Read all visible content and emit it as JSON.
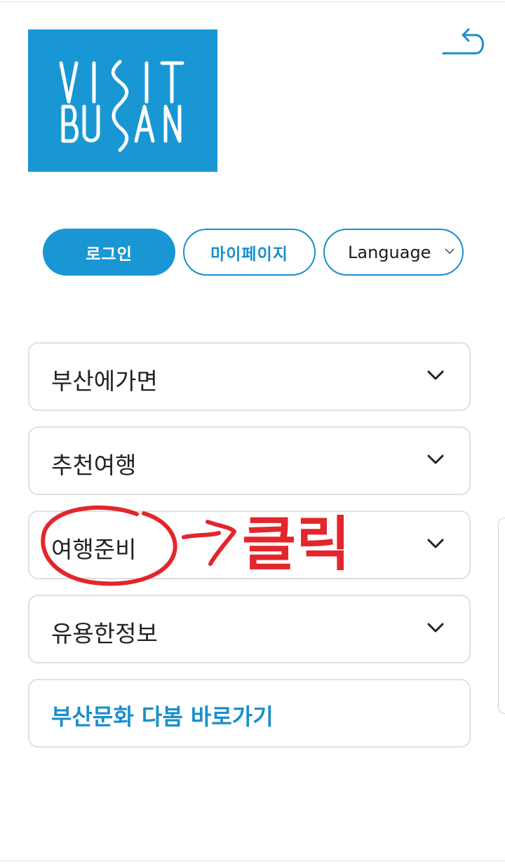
{
  "header": {
    "logo": {
      "line1": "VISIT",
      "line2": "BUSAN",
      "color": "#1997d4"
    },
    "back_icon": "back-arrow-icon"
  },
  "actions": {
    "login_label": "로그인",
    "mypage_label": "마이페이지",
    "language_label": "Language"
  },
  "menu": [
    {
      "label": "부산에가면",
      "icon": "chevron-down-icon"
    },
    {
      "label": "추천여행",
      "icon": "chevron-down-icon"
    },
    {
      "label": "여행준비",
      "icon": "chevron-down-icon"
    },
    {
      "label": "유용한정보",
      "icon": "chevron-down-icon"
    }
  ],
  "shortcut": {
    "label": "부산문화 다봄 바로가기"
  },
  "annotation": {
    "text": "클릭",
    "color": "#e3262b"
  },
  "colors": {
    "accent": "#1997d4",
    "text": "#222222",
    "border": "#e0e0e0"
  }
}
